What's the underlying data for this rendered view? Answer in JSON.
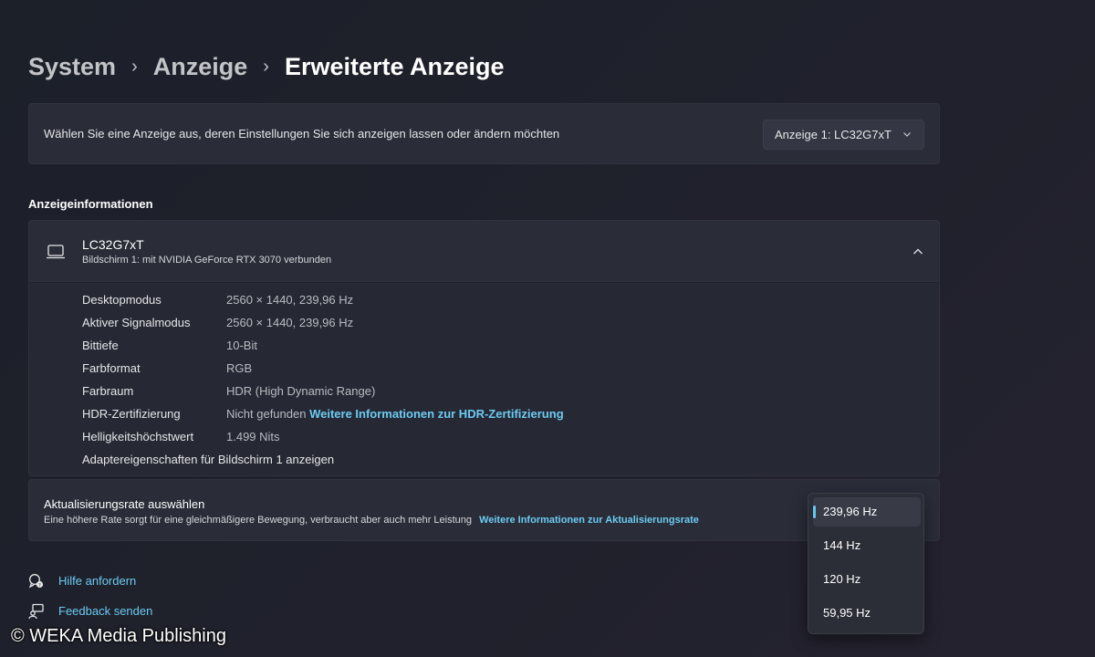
{
  "breadcrumb": {
    "items": [
      "System",
      "Anzeige",
      "Erweiterte Anzeige"
    ]
  },
  "display_select": {
    "label": "Wählen Sie eine Anzeige aus, deren Einstellungen Sie sich anzeigen lassen oder ändern möchten",
    "selected": "Anzeige 1: LC32G7xT"
  },
  "section_title": "Anzeigeinformationen",
  "monitor": {
    "name": "LC32G7xT",
    "subtitle": "Bildschirm 1: mit NVIDIA GeForce RTX 3070 verbunden",
    "icon": "monitor-icon",
    "rows": [
      {
        "key": "Desktopmodus",
        "value": "2560 × 1440, 239,96 Hz"
      },
      {
        "key": "Aktiver Signalmodus",
        "value": "2560 × 1440, 239,96 Hz"
      },
      {
        "key": "Bittiefe",
        "value": "10-Bit"
      },
      {
        "key": "Farbformat",
        "value": "RGB"
      },
      {
        "key": "Farbraum",
        "value": "HDR (High Dynamic Range)"
      },
      {
        "key": "HDR-Zertifizierung",
        "value": "Nicht gefunden",
        "link": "Weitere Informationen zur HDR-Zertifizierung"
      },
      {
        "key": "Helligkeitshöchstwert",
        "value": "1.499 Nits"
      }
    ],
    "adapter_link": "Adaptereigenschaften für Bildschirm 1 anzeigen"
  },
  "refresh_rate": {
    "title": "Aktualisierungsrate auswählen",
    "description": "Eine höhere Rate sorgt für eine gleichmäßigere Bewegung, verbraucht aber auch mehr Leistung",
    "link": "Weitere Informationen zur Aktualisierungsrate",
    "options": [
      "239,96 Hz",
      "144 Hz",
      "120 Hz",
      "59,95 Hz"
    ],
    "selected": "239,96 Hz"
  },
  "footer": {
    "help": "Hilfe anfordern",
    "feedback": "Feedback senden"
  },
  "watermark": "© WEKA Media Publishing",
  "colors": {
    "accent": "#6ccbf2",
    "background": "#1f222b",
    "card": "#2a2d38"
  }
}
